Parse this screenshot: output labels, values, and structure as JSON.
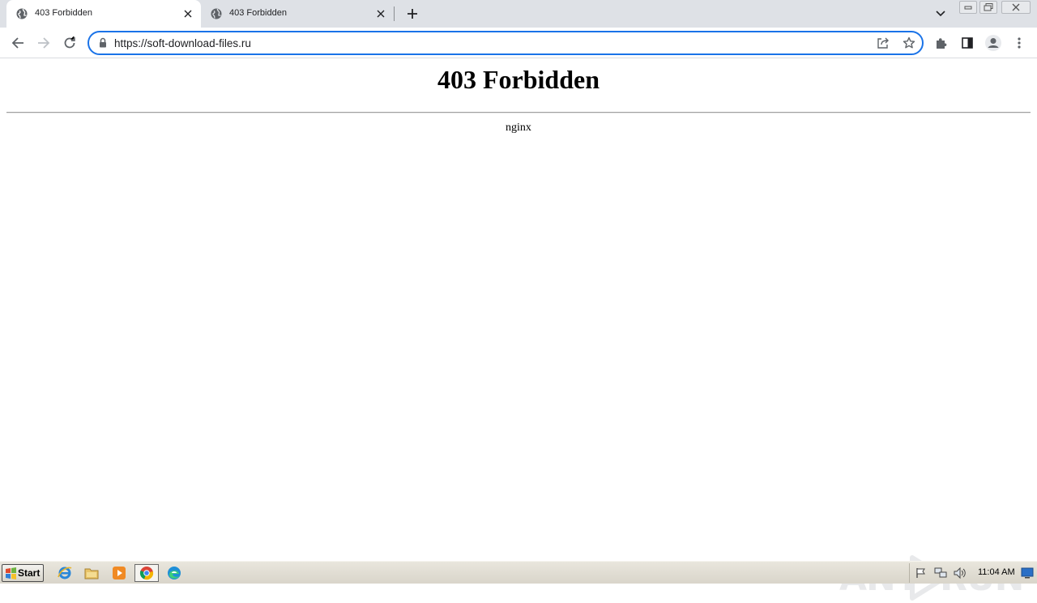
{
  "browser": {
    "tabs": [
      {
        "title": "403 Forbidden",
        "active": true
      },
      {
        "title": "403 Forbidden",
        "active": false
      }
    ],
    "address": "https://soft-download-files.ru",
    "accent": "#1a73e8"
  },
  "page": {
    "heading": "403 Forbidden",
    "server": "nginx"
  },
  "watermark": {
    "text_left": "ANY",
    "text_right": "RUN"
  },
  "taskbar": {
    "start_label": "Start",
    "clock": "11:04 AM",
    "pinned": [
      "internet-explorer-icon",
      "folder-icon",
      "media-player-icon",
      "chrome-icon",
      "edge-icon"
    ]
  }
}
